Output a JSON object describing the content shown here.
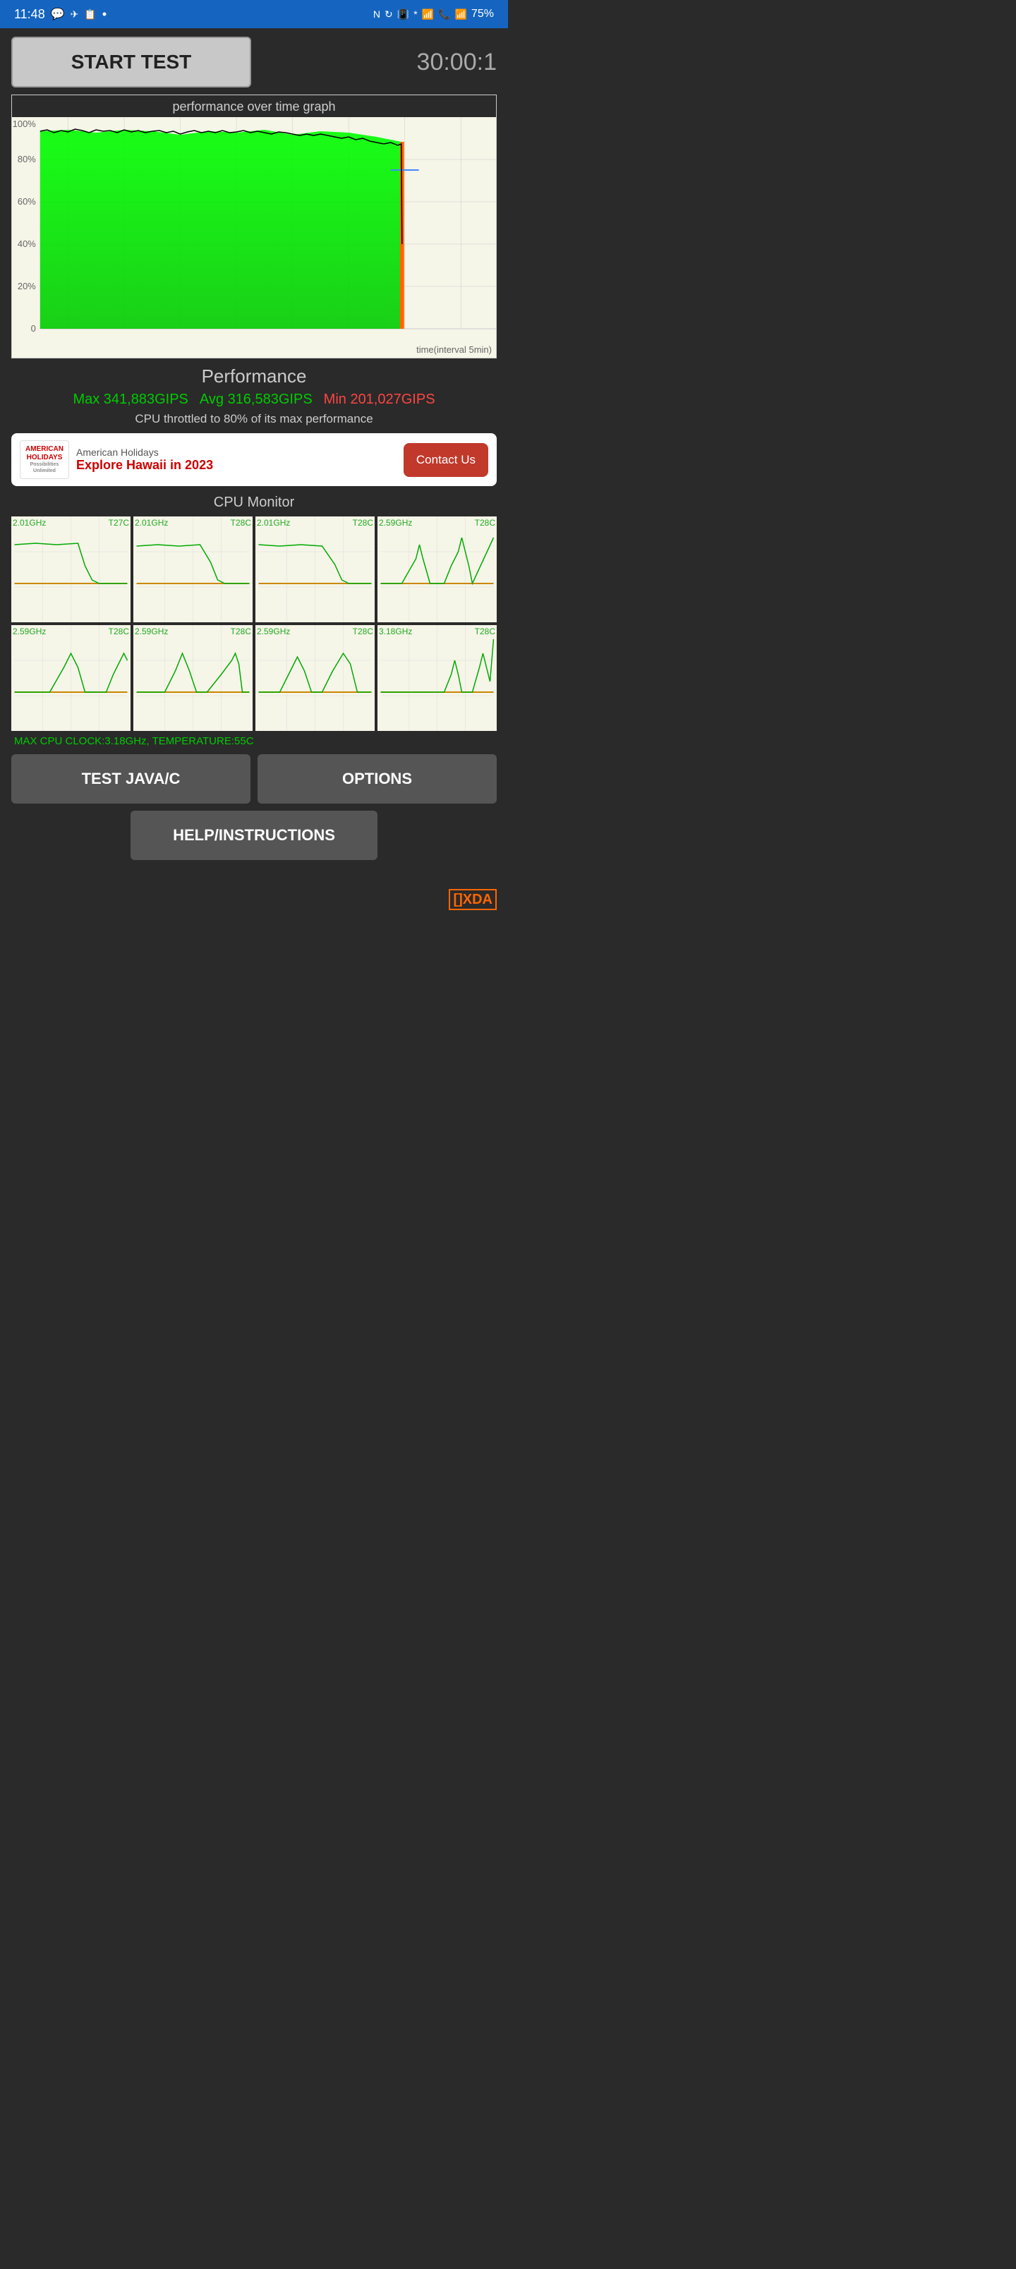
{
  "statusBar": {
    "time": "11:48",
    "battery": "75%"
  },
  "topRow": {
    "startTestLabel": "START TEST",
    "timer": "30:00:1"
  },
  "graph": {
    "title": "performance over time graph",
    "yLabels": [
      "100%",
      "80%",
      "60%",
      "40%",
      "20%",
      "0"
    ],
    "timeLabel": "time(interval 5min)"
  },
  "performance": {
    "title": "Performance",
    "maxLabel": "Max 341,883GIPS",
    "avgLabel": "Avg 316,583GIPS",
    "minLabel": "Min 201,027GIPS",
    "throttleText": "CPU throttled to 80% of its max performance"
  },
  "ad": {
    "logoLine1": "AMERICAN",
    "logoLine2": "HOLIDAYS",
    "logoLine3": "Possibilities Unlimited",
    "company": "American Holidays",
    "headline": "Explore Hawaii in 2023",
    "contactButton": "Contact Us"
  },
  "cpuMonitor": {
    "title": "CPU Monitor",
    "cells": [
      {
        "freq": "2.01GHz",
        "temp": "T27C"
      },
      {
        "freq": "2.01GHz",
        "temp": "T28C"
      },
      {
        "freq": "2.01GHz",
        "temp": "T28C"
      },
      {
        "freq": "2.59GHz",
        "temp": "T28C"
      },
      {
        "freq": "2.59GHz",
        "temp": "T28C"
      },
      {
        "freq": "2.59GHz",
        "temp": "T28C"
      },
      {
        "freq": "2.59GHz",
        "temp": "T28C"
      },
      {
        "freq": "3.18GHz",
        "temp": "T28C"
      }
    ],
    "maxInfo": "MAX CPU CLOCK:3.18GHz,  TEMPERATURE:55C"
  },
  "buttons": {
    "testJavaC": "TEST JAVA/C",
    "options": "OPTIONS",
    "helpInstructions": "HELP/INSTRUCTIONS"
  },
  "xda": {
    "logo": "[]XDA"
  }
}
